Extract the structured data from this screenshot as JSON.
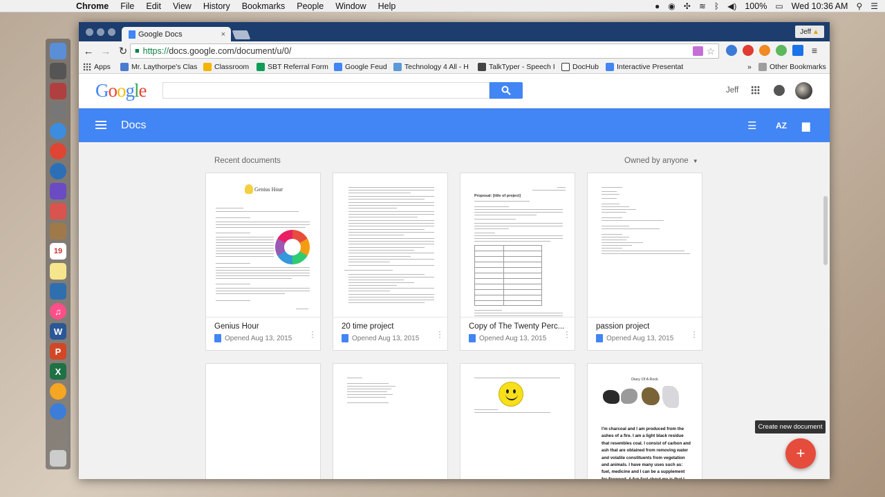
{
  "menubar": {
    "items": [
      "Chrome",
      "File",
      "Edit",
      "View",
      "History",
      "Bookmarks",
      "People",
      "Window",
      "Help"
    ],
    "battery": "100%",
    "clock": "Wed 10:36 AM"
  },
  "browser": {
    "tab_title": "Google Docs",
    "tab_close": "×",
    "profile_name": "Jeff",
    "url_https": "https://",
    "url_rest": "docs.google.com/document/u/0/",
    "bookmarks": [
      {
        "label": "Apps"
      },
      {
        "label": "Mr. Laythorpe's Clas"
      },
      {
        "label": "Classroom"
      },
      {
        "label": "SBT Referral Form"
      },
      {
        "label": "Google Feud"
      },
      {
        "label": "Technology 4 All - H"
      },
      {
        "label": "TalkTyper - Speech I"
      },
      {
        "label": "DocHub"
      },
      {
        "label": "Interactive Presentat"
      }
    ],
    "more_bookmarks": "»",
    "other_bookmarks": "Other Bookmarks"
  },
  "google_header": {
    "logo": "Google",
    "search_placeholder": "",
    "user_name": "Jeff"
  },
  "docs_bar": {
    "title": "Docs"
  },
  "content": {
    "recent_label": "Recent documents",
    "owner_filter": "Owned by anyone",
    "documents": [
      {
        "title": "Genius Hour",
        "opened": "Opened  Aug 13, 2015"
      },
      {
        "title": "20 time project",
        "opened": "Opened  Aug 13, 2015"
      },
      {
        "title": "Copy of The Twenty Perc...",
        "opened": "Opened  Aug 13, 2015"
      },
      {
        "title": "passion project",
        "opened": "Opened  Aug 13, 2015"
      }
    ],
    "preview_genius_title": "Genius Hour",
    "preview_proposal_title": "Proposal: [title of project]",
    "preview_diary_title": "Diary Of A Rock",
    "preview_diary_text": "I'm charcoal and I am produced from the ashes of a fire. I am a light black residue that resembles coal. I consist of carbon and ash that are obtained from removing water and volatile constituents from vegetation and animals. I have many uses such as: fuel, medicine and I can be a supplement for firewood. A fun fact about me is that I can be used to draw"
  },
  "fab": {
    "tooltip": "Create new document",
    "icon": "+"
  },
  "colors": {
    "docs_blue": "#4285f4",
    "fab_red": "#e64c3c",
    "titlebar": "#1c3d6e"
  }
}
